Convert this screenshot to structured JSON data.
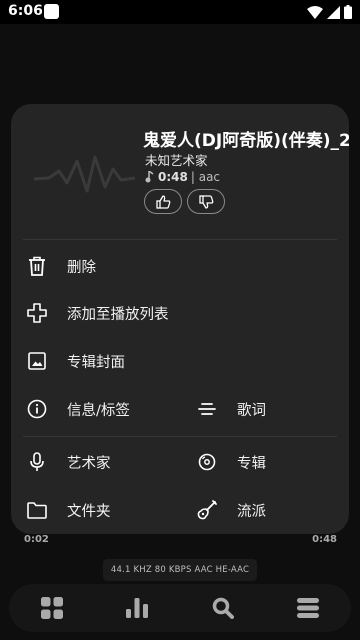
{
  "status_bar": {
    "time": "6:06",
    "icons": [
      "notification-icon",
      "wifi-icon",
      "signal-icon",
      "battery-icon"
    ]
  },
  "player": {
    "elapsed": "0:02",
    "duration": "0:48",
    "codec_info": "44.1 KHZ  80 KBPS  AAC HE-AAC",
    "nav": [
      "grid-icon",
      "bars-icon",
      "search-icon",
      "menu-icon"
    ]
  },
  "sheet": {
    "title": "鬼爱人(DJ阿奇版)(伴奏)_2",
    "artist": "未知艺术家",
    "duration": "0:48",
    "format": "| aac",
    "actions": {
      "delete": "删除",
      "add_to_playlist": "添加至播放列表",
      "album_cover": "专辑封面",
      "info_tags": "信息/标签",
      "lyrics": "歌词",
      "artist": "艺术家",
      "album": "专辑",
      "folder": "文件夹",
      "genre": "流派"
    }
  },
  "colors": {
    "background": "#000000",
    "sheet": "#252525",
    "text": "#ffffff",
    "secondary_text": "#bdbdbd"
  }
}
